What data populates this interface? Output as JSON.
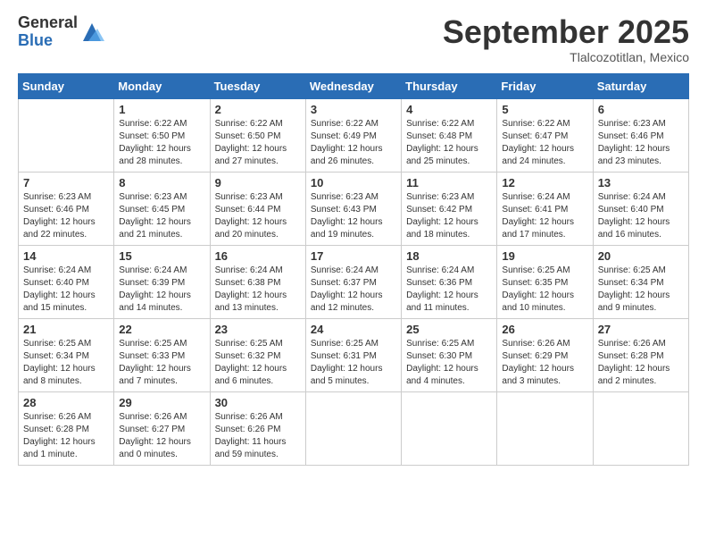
{
  "logo": {
    "general": "General",
    "blue": "Blue"
  },
  "header": {
    "month": "September 2025",
    "location": "Tlalcozotitlan, Mexico"
  },
  "weekdays": [
    "Sunday",
    "Monday",
    "Tuesday",
    "Wednesday",
    "Thursday",
    "Friday",
    "Saturday"
  ],
  "weeks": [
    [
      {
        "day": "",
        "info": ""
      },
      {
        "day": "1",
        "info": "Sunrise: 6:22 AM\nSunset: 6:50 PM\nDaylight: 12 hours\nand 28 minutes."
      },
      {
        "day": "2",
        "info": "Sunrise: 6:22 AM\nSunset: 6:50 PM\nDaylight: 12 hours\nand 27 minutes."
      },
      {
        "day": "3",
        "info": "Sunrise: 6:22 AM\nSunset: 6:49 PM\nDaylight: 12 hours\nand 26 minutes."
      },
      {
        "day": "4",
        "info": "Sunrise: 6:22 AM\nSunset: 6:48 PM\nDaylight: 12 hours\nand 25 minutes."
      },
      {
        "day": "5",
        "info": "Sunrise: 6:22 AM\nSunset: 6:47 PM\nDaylight: 12 hours\nand 24 minutes."
      },
      {
        "day": "6",
        "info": "Sunrise: 6:23 AM\nSunset: 6:46 PM\nDaylight: 12 hours\nand 23 minutes."
      }
    ],
    [
      {
        "day": "7",
        "info": "Sunrise: 6:23 AM\nSunset: 6:46 PM\nDaylight: 12 hours\nand 22 minutes."
      },
      {
        "day": "8",
        "info": "Sunrise: 6:23 AM\nSunset: 6:45 PM\nDaylight: 12 hours\nand 21 minutes."
      },
      {
        "day": "9",
        "info": "Sunrise: 6:23 AM\nSunset: 6:44 PM\nDaylight: 12 hours\nand 20 minutes."
      },
      {
        "day": "10",
        "info": "Sunrise: 6:23 AM\nSunset: 6:43 PM\nDaylight: 12 hours\nand 19 minutes."
      },
      {
        "day": "11",
        "info": "Sunrise: 6:23 AM\nSunset: 6:42 PM\nDaylight: 12 hours\nand 18 minutes."
      },
      {
        "day": "12",
        "info": "Sunrise: 6:24 AM\nSunset: 6:41 PM\nDaylight: 12 hours\nand 17 minutes."
      },
      {
        "day": "13",
        "info": "Sunrise: 6:24 AM\nSunset: 6:40 PM\nDaylight: 12 hours\nand 16 minutes."
      }
    ],
    [
      {
        "day": "14",
        "info": "Sunrise: 6:24 AM\nSunset: 6:40 PM\nDaylight: 12 hours\nand 15 minutes."
      },
      {
        "day": "15",
        "info": "Sunrise: 6:24 AM\nSunset: 6:39 PM\nDaylight: 12 hours\nand 14 minutes."
      },
      {
        "day": "16",
        "info": "Sunrise: 6:24 AM\nSunset: 6:38 PM\nDaylight: 12 hours\nand 13 minutes."
      },
      {
        "day": "17",
        "info": "Sunrise: 6:24 AM\nSunset: 6:37 PM\nDaylight: 12 hours\nand 12 minutes."
      },
      {
        "day": "18",
        "info": "Sunrise: 6:24 AM\nSunset: 6:36 PM\nDaylight: 12 hours\nand 11 minutes."
      },
      {
        "day": "19",
        "info": "Sunrise: 6:25 AM\nSunset: 6:35 PM\nDaylight: 12 hours\nand 10 minutes."
      },
      {
        "day": "20",
        "info": "Sunrise: 6:25 AM\nSunset: 6:34 PM\nDaylight: 12 hours\nand 9 minutes."
      }
    ],
    [
      {
        "day": "21",
        "info": "Sunrise: 6:25 AM\nSunset: 6:34 PM\nDaylight: 12 hours\nand 8 minutes."
      },
      {
        "day": "22",
        "info": "Sunrise: 6:25 AM\nSunset: 6:33 PM\nDaylight: 12 hours\nand 7 minutes."
      },
      {
        "day": "23",
        "info": "Sunrise: 6:25 AM\nSunset: 6:32 PM\nDaylight: 12 hours\nand 6 minutes."
      },
      {
        "day": "24",
        "info": "Sunrise: 6:25 AM\nSunset: 6:31 PM\nDaylight: 12 hours\nand 5 minutes."
      },
      {
        "day": "25",
        "info": "Sunrise: 6:25 AM\nSunset: 6:30 PM\nDaylight: 12 hours\nand 4 minutes."
      },
      {
        "day": "26",
        "info": "Sunrise: 6:26 AM\nSunset: 6:29 PM\nDaylight: 12 hours\nand 3 minutes."
      },
      {
        "day": "27",
        "info": "Sunrise: 6:26 AM\nSunset: 6:28 PM\nDaylight: 12 hours\nand 2 minutes."
      }
    ],
    [
      {
        "day": "28",
        "info": "Sunrise: 6:26 AM\nSunset: 6:28 PM\nDaylight: 12 hours\nand 1 minute."
      },
      {
        "day": "29",
        "info": "Sunrise: 6:26 AM\nSunset: 6:27 PM\nDaylight: 12 hours\nand 0 minutes."
      },
      {
        "day": "30",
        "info": "Sunrise: 6:26 AM\nSunset: 6:26 PM\nDaylight: 11 hours\nand 59 minutes."
      },
      {
        "day": "",
        "info": ""
      },
      {
        "day": "",
        "info": ""
      },
      {
        "day": "",
        "info": ""
      },
      {
        "day": "",
        "info": ""
      }
    ]
  ]
}
